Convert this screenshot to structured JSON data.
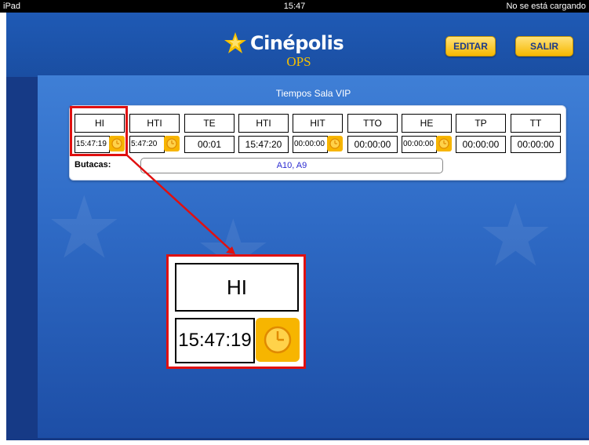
{
  "status_bar": {
    "device": "iPad",
    "time": "15:47",
    "battery_text": "No se está cargando"
  },
  "header": {
    "brand": "Cinépolis",
    "subtitle": "OPS",
    "edit_label": "EDITAR",
    "exit_label": "SALIR"
  },
  "panel": {
    "title": "Tiempos Sala VIP"
  },
  "table": {
    "headers": [
      "HI",
      "HTI",
      "TE",
      "HTI",
      "HIT",
      "TTO",
      "HE",
      "TP",
      "TT"
    ],
    "values": [
      "15:47:19",
      "5:47:20",
      "00:01",
      "15:47:20",
      "00:00:00",
      "00:00:00",
      "00:00:00",
      "00:00:00",
      "00:00:00"
    ]
  },
  "seats": {
    "label": "Butacas:",
    "value": "A10, A9"
  },
  "zoom": {
    "header": "HI",
    "value": "15:47:19"
  },
  "colors": {
    "accent": "#f7b500",
    "highlight": "#e01010",
    "background": "#163a86"
  }
}
